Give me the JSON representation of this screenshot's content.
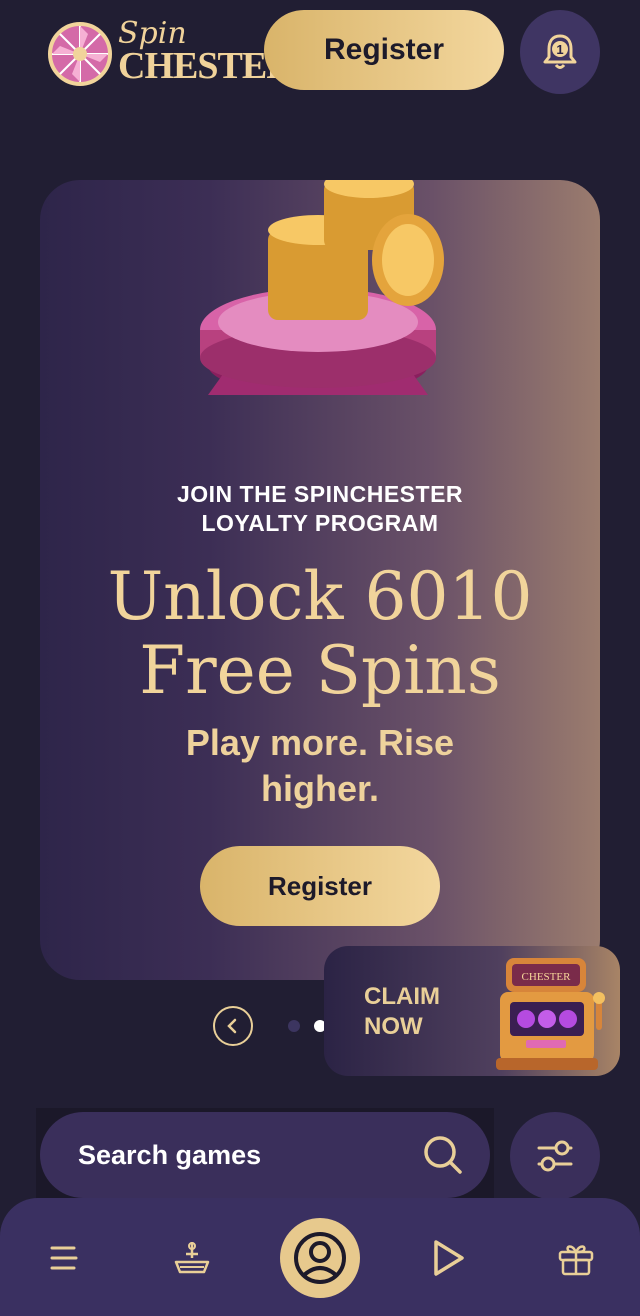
{
  "header": {
    "logo_line1": "Spin",
    "logo_line2": "CHESTER",
    "register_label": "Register",
    "notification_count": "1"
  },
  "hero": {
    "eyebrow": "JOIN THE SPINCHESTER\nLOYALTY PROGRAM",
    "title": "Unlock 6010\nFree Spins",
    "subtitle": "Play more. Rise higher.",
    "register_label": "Register"
  },
  "carousel": {
    "dots": 2,
    "active_dot": 2
  },
  "claim": {
    "label": "CLAIM\nNOW",
    "slot_sign": "CHESTER"
  },
  "search": {
    "placeholder": "Search games"
  },
  "bottom_nav": {
    "items": [
      "menu-icon",
      "trophy-icon",
      "profile-icon",
      "play-icon",
      "gift-icon"
    ]
  },
  "colors": {
    "background": "#211e33",
    "accent_gold": "#e7c98d",
    "panel_purple": "#3a2f5b"
  }
}
